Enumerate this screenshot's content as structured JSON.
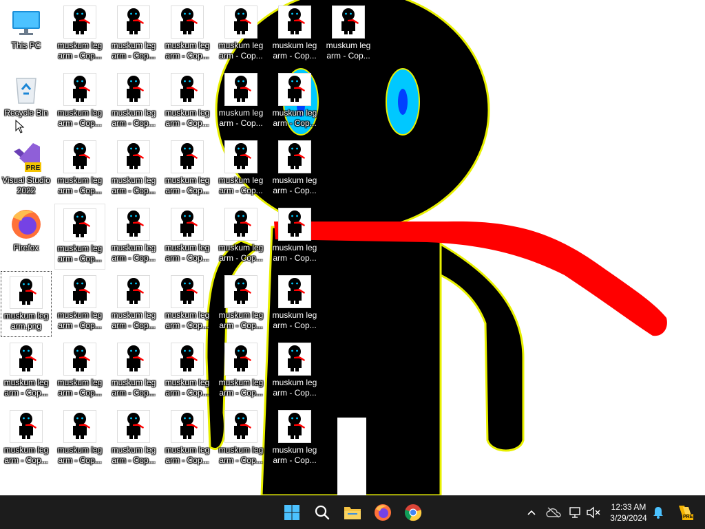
{
  "desktop": {
    "system_icons": [
      {
        "label": "This PC",
        "icon": "computer-icon"
      },
      {
        "label": "Recycle Bin",
        "icon": "recycle-bin-icon"
      },
      {
        "label": "Visual Studio 2022 Preview",
        "icon": "visual-studio-icon",
        "badge": "PRE"
      },
      {
        "label": "Firefox",
        "icon": "firefox-icon"
      }
    ],
    "selected_file": {
      "label": "muskum leg arm.png"
    },
    "file_copy_label": "muskum leg arm - Cop..."
  },
  "taskbar": {
    "pinned": [
      {
        "name": "start-button",
        "icon": "windows-icon"
      },
      {
        "name": "search-button",
        "icon": "search-icon"
      },
      {
        "name": "file-explorer-button",
        "icon": "folder-icon"
      },
      {
        "name": "firefox-taskbar-button",
        "icon": "firefox-icon"
      },
      {
        "name": "chrome-taskbar-button",
        "icon": "chrome-icon"
      }
    ],
    "tray": {
      "time": "12:33 AM",
      "date": "3/29/2024",
      "copilot_badge": "PRE"
    }
  },
  "colors": {
    "taskbar": "#1c1c1c",
    "wallpaper_figure": "#000000",
    "wallpaper_outline": "#e8f000",
    "wallpaper_scarf": "#ff0000",
    "wallpaper_eye": "#00c8ff"
  }
}
